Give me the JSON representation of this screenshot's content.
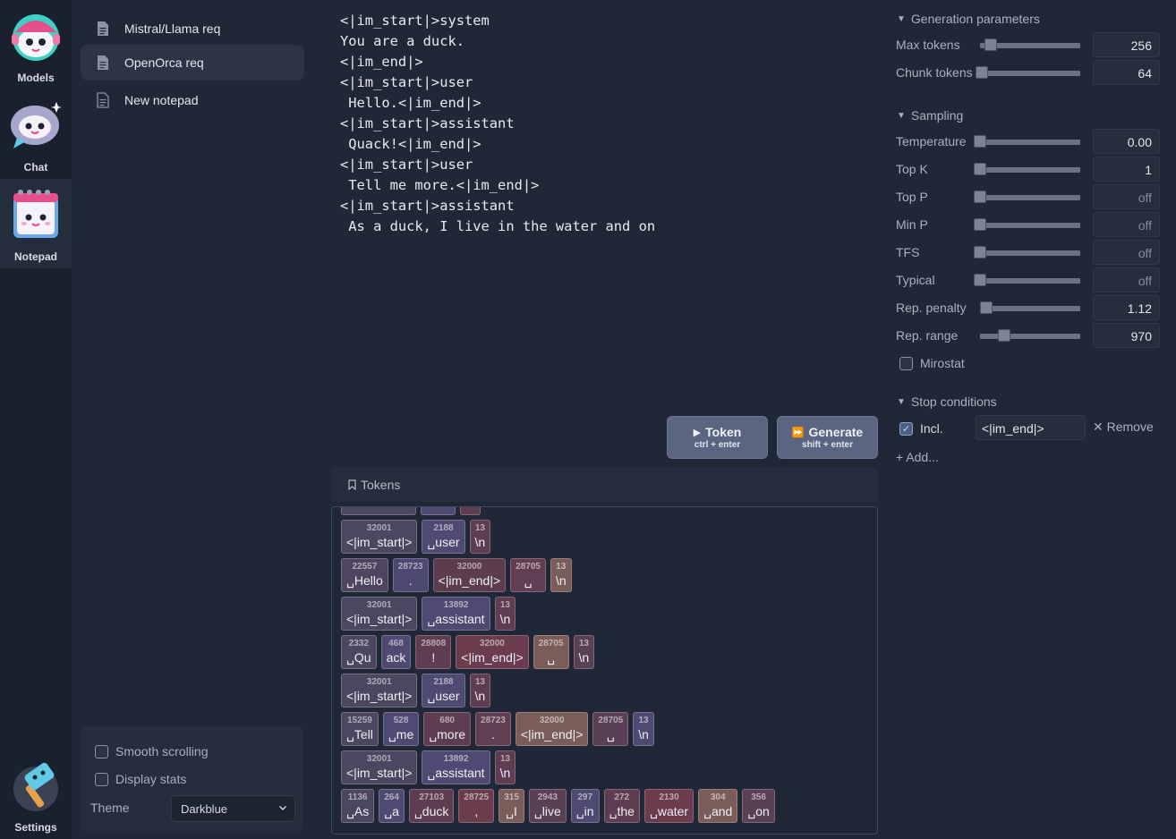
{
  "nav": {
    "models": "Models",
    "chat": "Chat",
    "notepad": "Notepad",
    "settings": "Settings"
  },
  "notepads": [
    {
      "label": "Mistral/Llama req"
    },
    {
      "label": "OpenOrca req"
    },
    {
      "label": "New notepad"
    }
  ],
  "settings": {
    "smooth_scrolling": "Smooth scrolling",
    "display_stats": "Display stats",
    "theme_label": "Theme",
    "theme_value": "Darkblue"
  },
  "editor": {
    "text": "<|im_start|>system\nYou are a duck.\n<|im_end|>\n<|im_start|>user\n Hello.<|im_end|>\n<|im_start|>assistant\n Quack!<|im_end|>\n<|im_start|>user\n Tell me more.<|im_end|>\n<|im_start|>assistant\n As a duck, I live in the water and on"
  },
  "buttons": {
    "token_label": "Token",
    "token_hint": "ctrl + enter",
    "generate_label": "Generate",
    "generate_hint": "shift + enter"
  },
  "tokens_panel": {
    "title": "Tokens",
    "rows": [
      [
        {
          "id": "32001",
          "text": "<|im_start|>",
          "color": "#4d4660"
        },
        {
          "id": "2188",
          "text": "␣user",
          "color": "#4e4a72"
        },
        {
          "id": "13",
          "text": "\\n",
          "color": "#5e3d50"
        }
      ],
      [
        {
          "id": "22557",
          "text": "␣Hello",
          "color": "#4e4560"
        },
        {
          "id": "28723",
          "text": ".",
          "color": "#4d4870"
        },
        {
          "id": "32000",
          "text": "<|im_end|>",
          "color": "#5d3c4e"
        },
        {
          "id": "28705",
          "text": "␣",
          "color": "#623e52"
        },
        {
          "id": "13",
          "text": "\\n",
          "color": "#7a5d58"
        }
      ],
      [
        {
          "id": "32001",
          "text": "<|im_start|>",
          "color": "#4d4660"
        },
        {
          "id": "13892",
          "text": "␣assistant",
          "color": "#4e4a72"
        },
        {
          "id": "13",
          "text": "\\n",
          "color": "#5e3d50"
        }
      ],
      [
        {
          "id": "2332",
          "text": "␣Qu",
          "color": "#4d4660"
        },
        {
          "id": "468",
          "text": "ack",
          "color": "#4e4a72"
        },
        {
          "id": "28808",
          "text": "!",
          "color": "#5e3d50"
        },
        {
          "id": "32000",
          "text": "<|im_end|>",
          "color": "#6a3c4e"
        },
        {
          "id": "28705",
          "text": "␣",
          "color": "#7a5d58"
        },
        {
          "id": "13",
          "text": "\\n",
          "color": "#5a4055"
        }
      ],
      [
        {
          "id": "32001",
          "text": "<|im_start|>",
          "color": "#4d4660"
        },
        {
          "id": "2188",
          "text": "␣user",
          "color": "#4e4a72"
        },
        {
          "id": "13",
          "text": "\\n",
          "color": "#5e3d50"
        }
      ],
      [
        {
          "id": "15259",
          "text": "␣Tell",
          "color": "#4d4660"
        },
        {
          "id": "528",
          "text": "␣me",
          "color": "#4e4a72"
        },
        {
          "id": "680",
          "text": "␣more",
          "color": "#5e3d50"
        },
        {
          "id": "28723",
          "text": ".",
          "color": "#623e52"
        },
        {
          "id": "32000",
          "text": "<|im_end|>",
          "color": "#7a5d58"
        },
        {
          "id": "28705",
          "text": "␣",
          "color": "#5a4055"
        },
        {
          "id": "13",
          "text": "\\n",
          "color": "#4e4a72"
        }
      ],
      [
        {
          "id": "32001",
          "text": "<|im_start|>",
          "color": "#4d4660"
        },
        {
          "id": "13892",
          "text": "␣assistant",
          "color": "#4e4a72"
        },
        {
          "id": "13",
          "text": "\\n",
          "color": "#5e3d50"
        }
      ],
      [
        {
          "id": "1136",
          "text": "␣As",
          "color": "#4d4660"
        },
        {
          "id": "264",
          "text": "␣a",
          "color": "#4e4a72"
        },
        {
          "id": "27103",
          "text": "␣duck",
          "color": "#5e3d50"
        },
        {
          "id": "28725",
          "text": ",",
          "color": "#6a3c4e"
        },
        {
          "id": "315",
          "text": "␣I",
          "color": "#7a5d58"
        },
        {
          "id": "2943",
          "text": "␣live",
          "color": "#5a4055"
        },
        {
          "id": "297",
          "text": "␣in",
          "color": "#4e4a72"
        },
        {
          "id": "272",
          "text": "␣the",
          "color": "#5e3d50"
        },
        {
          "id": "2130",
          "text": "␣water",
          "color": "#6a3c4e"
        },
        {
          "id": "304",
          "text": "␣and",
          "color": "#7a5d58"
        },
        {
          "id": "356",
          "text": "␣on",
          "color": "#5a4055"
        }
      ]
    ]
  },
  "generation_params": {
    "title": "Generation parameters",
    "params": [
      {
        "label": "Max tokens",
        "value": "256",
        "level": 0.11
      },
      {
        "label": "Chunk tokens",
        "value": "64",
        "level": 0.02
      }
    ]
  },
  "sampling": {
    "title": "Sampling",
    "params": [
      {
        "label": "Temperature",
        "value": "0.00",
        "level": 0
      },
      {
        "label": "Top K",
        "value": "1",
        "level": 0
      },
      {
        "label": "Top P",
        "value": "off",
        "level": 0
      },
      {
        "label": "Min P",
        "value": "off",
        "level": 0
      },
      {
        "label": "TFS",
        "value": "off",
        "level": 0
      },
      {
        "label": "Typical",
        "value": "off",
        "level": 0
      },
      {
        "label": "Rep. penalty",
        "value": "1.12",
        "level": 0.06
      },
      {
        "label": "Rep. range",
        "value": "970",
        "level": 0.24
      }
    ],
    "mirostat": "Mirostat"
  },
  "stop_conditions": {
    "title": "Stop conditions",
    "incl_label": "Incl.",
    "stop_value": "<|im_end|>",
    "remove_label": "✕ Remove",
    "add_label": "+ Add..."
  }
}
